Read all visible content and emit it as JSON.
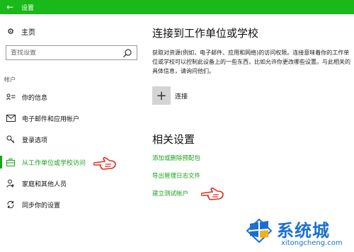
{
  "window": {
    "title": "设置",
    "back_icon": "back-arrow-icon"
  },
  "sidebar": {
    "home_label": "主页",
    "search_placeholder": "查找设置",
    "section_label": "帐户",
    "items": [
      {
        "label": "你的信息",
        "icon": "person-card-icon"
      },
      {
        "label": "电子邮件和应用帐户",
        "icon": "mail-icon"
      },
      {
        "label": "登录选项",
        "icon": "key-icon"
      },
      {
        "label": "从工作单位或学校访问",
        "icon": "briefcase-icon",
        "active": true
      },
      {
        "label": "家庭和其他人员",
        "icon": "person-add-icon"
      },
      {
        "label": "同步你的设置",
        "icon": "sync-icon"
      }
    ]
  },
  "main": {
    "heading": "连接到工作单位或学校",
    "description": "获取对资源(例如，电子邮件、应用和网络)的访问权限。连接意味着你的工作单位或学校可以控制此设备上的一些东西，比如允许你更改哪些设置。与此相关的具体信息，请询问他们。",
    "connect_label": "连接",
    "related_heading": "相关设置",
    "links": [
      "添加或删除预配包",
      "导出管理日志文件",
      "建立测试帐户"
    ]
  },
  "watermark": {
    "cn": "系统城",
    "en": "xitongcheng.com"
  },
  "colors": {
    "accent": "#1aa31a",
    "titlebar": "#18b918",
    "watermark": "#1a6fd1"
  }
}
